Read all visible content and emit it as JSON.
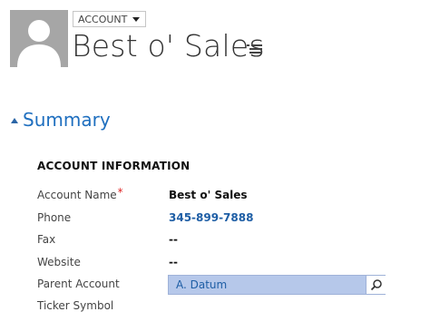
{
  "header": {
    "entity_label": "ACCOUNT",
    "record_name": "Best o' Sales"
  },
  "section": {
    "title": "Summary"
  },
  "subsection": {
    "title": "ACCOUNT INFORMATION"
  },
  "fields": [
    {
      "label": "Account Name",
      "required_mark": "*",
      "value": "Best o' Sales"
    },
    {
      "label": "Phone",
      "value": "345-899-7888"
    },
    {
      "label": "Fax",
      "value": "--"
    },
    {
      "label": "Website",
      "value": "--"
    },
    {
      "label": "Parent Account",
      "value": "A. Datum"
    }
  ],
  "partial_row_label": "Ticker Symbol",
  "colors": {
    "accent": "#1f6fbf",
    "link": "#1e5ea5",
    "lookup_bg": "#b6c8ea",
    "required": "#dd2222"
  },
  "icons": {
    "avatar": "person-placeholder-icon",
    "entity_dropdown": "chevron-down-icon",
    "title_menu": "list-menu-icon",
    "collapse": "collapse-triangle-icon",
    "lookup": "search-icon"
  }
}
